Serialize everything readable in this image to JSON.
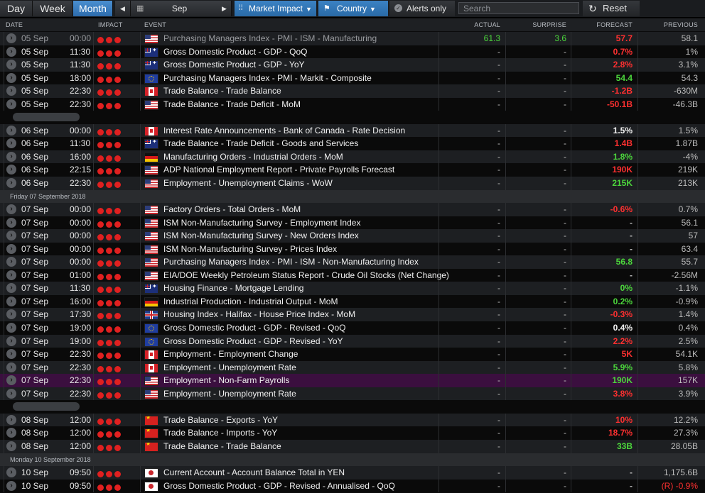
{
  "toolbar": {
    "day": "Day",
    "week": "Week",
    "month": "Month",
    "prev": "◀",
    "calendar_icon": "calendar-icon",
    "period": "Sep",
    "next": "▶",
    "market_impact": "Market Impact",
    "country": "Country",
    "alerts_only": "Alerts only",
    "search_placeholder": "Search",
    "reset": "Reset"
  },
  "columns": {
    "date": "DATE",
    "impact": "IMPACT",
    "event": "EVENT",
    "actual": "ACTUAL",
    "surprise": "SURPRISE",
    "forecast": "FORECAST",
    "previous": "PREVIOUS"
  },
  "colors": {
    "accent": "#2d6cad",
    "positive": "#4cd63c",
    "negative": "#ff3030",
    "impact": "#e02020",
    "highlight": "#3b0f3f"
  },
  "rows": [
    {
      "kind": "row",
      "date": "05 Sep",
      "time": "00:00",
      "flag": "us",
      "event": "Purchasing Managers Index - PMI - ISM - Manufacturing",
      "actual": "61.3",
      "actual_c": "pos",
      "surprise": "3.6",
      "surprise_c": "pos",
      "forecast": "57.7",
      "forecast_c": "neg",
      "previous": "58.1",
      "dim": true
    },
    {
      "kind": "row",
      "date": "05 Sep",
      "time": "11:30",
      "flag": "au",
      "event": "Gross Domestic Product - GDP - QoQ",
      "actual": "-",
      "surprise": "-",
      "forecast": "0.7%",
      "forecast_c": "neg",
      "previous": "1%"
    },
    {
      "kind": "row",
      "date": "05 Sep",
      "time": "11:30",
      "flag": "au",
      "event": "Gross Domestic Product - GDP - YoY",
      "actual": "-",
      "surprise": "-",
      "forecast": "2.8%",
      "forecast_c": "neg",
      "previous": "3.1%"
    },
    {
      "kind": "row",
      "date": "05 Sep",
      "time": "18:00",
      "flag": "eu",
      "event": "Purchasing Managers Index - PMI - Markit - Composite",
      "actual": "-",
      "surprise": "-",
      "forecast": "54.4",
      "forecast_c": "pos",
      "previous": "54.3"
    },
    {
      "kind": "row",
      "date": "05 Sep",
      "time": "22:30",
      "flag": "ca",
      "event": "Trade Balance - Trade Balance",
      "actual": "-",
      "surprise": "-",
      "forecast": "-1.2B",
      "forecast_c": "neg",
      "previous": "-630M"
    },
    {
      "kind": "row",
      "date": "05 Sep",
      "time": "22:30",
      "flag": "us",
      "event": "Trade Balance - Trade Deficit - MoM",
      "actual": "-",
      "surprise": "-",
      "forecast": "-50.1B",
      "forecast_c": "neg",
      "previous": "-46.3B"
    },
    {
      "kind": "gap"
    },
    {
      "kind": "row",
      "date": "06 Sep",
      "time": "00:00",
      "flag": "ca",
      "event": "Interest Rate Announcements - Bank of Canada - Rate Decision",
      "actual": "-",
      "surprise": "-",
      "forecast": "1.5%",
      "forecast_c": "neu",
      "previous": "1.5%"
    },
    {
      "kind": "row",
      "date": "06 Sep",
      "time": "11:30",
      "flag": "au",
      "event": "Trade Balance - Trade Deficit - Goods and Services",
      "actual": "-",
      "surprise": "-",
      "forecast": "1.4B",
      "forecast_c": "neg",
      "previous": "1.87B"
    },
    {
      "kind": "row",
      "date": "06 Sep",
      "time": "16:00",
      "flag": "de",
      "event": "Manufacturing Orders - Industrial Orders - MoM",
      "actual": "-",
      "surprise": "-",
      "forecast": "1.8%",
      "forecast_c": "pos",
      "previous": "-4%"
    },
    {
      "kind": "row",
      "date": "06 Sep",
      "time": "22:15",
      "flag": "us",
      "event": "ADP National Employment Report - Private Payrolls Forecast",
      "actual": "-",
      "surprise": "-",
      "forecast": "190K",
      "forecast_c": "neg",
      "previous": "219K"
    },
    {
      "kind": "row",
      "date": "06 Sep",
      "time": "22:30",
      "flag": "us",
      "event": "Employment - Unemployment Claims - WoW",
      "actual": "-",
      "surprise": "-",
      "forecast": "215K",
      "forecast_c": "pos",
      "previous": "213K"
    },
    {
      "kind": "group",
      "label": "Friday 07 September 2018"
    },
    {
      "kind": "row",
      "date": "07 Sep",
      "time": "00:00",
      "flag": "us",
      "event": "Factory Orders - Total Orders - MoM",
      "actual": "-",
      "surprise": "-",
      "forecast": "-0.6%",
      "forecast_c": "neg",
      "previous": "0.7%"
    },
    {
      "kind": "row",
      "date": "07 Sep",
      "time": "00:00",
      "flag": "us",
      "event": "ISM Non-Manufacturing Survey - Employment Index",
      "actual": "-",
      "surprise": "-",
      "forecast": "-",
      "forecast_c": "dash",
      "previous": "56.1"
    },
    {
      "kind": "row",
      "date": "07 Sep",
      "time": "00:00",
      "flag": "us",
      "event": "ISM Non-Manufacturing Survey - New Orders Index",
      "actual": "-",
      "surprise": "-",
      "forecast": "-",
      "forecast_c": "dash",
      "previous": "57"
    },
    {
      "kind": "row",
      "date": "07 Sep",
      "time": "00:00",
      "flag": "us",
      "event": "ISM Non-Manufacturing Survey - Prices Index",
      "actual": "-",
      "surprise": "-",
      "forecast": "-",
      "forecast_c": "dash",
      "previous": "63.4"
    },
    {
      "kind": "row",
      "date": "07 Sep",
      "time": "00:00",
      "flag": "us",
      "event": "Purchasing Managers Index - PMI - ISM - Non-Manufacturing Index",
      "actual": "-",
      "surprise": "-",
      "forecast": "56.8",
      "forecast_c": "pos",
      "previous": "55.7"
    },
    {
      "kind": "row",
      "date": "07 Sep",
      "time": "01:00",
      "flag": "us",
      "event": "EIA/DOE Weekly Petroleum Status Report - Crude Oil Stocks (Net Change)",
      "actual": "-",
      "surprise": "-",
      "forecast": "-",
      "forecast_c": "dash",
      "previous": "-2.56M"
    },
    {
      "kind": "row",
      "date": "07 Sep",
      "time": "11:30",
      "flag": "au",
      "event": "Housing Finance - Mortgage Lending",
      "actual": "-",
      "surprise": "-",
      "forecast": "0%",
      "forecast_c": "pos",
      "previous": "-1.1%"
    },
    {
      "kind": "row",
      "date": "07 Sep",
      "time": "16:00",
      "flag": "de",
      "event": "Industrial Production - Industrial Output - MoM",
      "actual": "-",
      "surprise": "-",
      "forecast": "0.2%",
      "forecast_c": "pos",
      "previous": "-0.9%"
    },
    {
      "kind": "row",
      "date": "07 Sep",
      "time": "17:30",
      "flag": "gb",
      "event": "Housing Index - Halifax - House Price Index - MoM",
      "actual": "-",
      "surprise": "-",
      "forecast": "-0.3%",
      "forecast_c": "neg",
      "previous": "1.4%"
    },
    {
      "kind": "row",
      "date": "07 Sep",
      "time": "19:00",
      "flag": "eu",
      "event": "Gross Domestic Product - GDP - Revised - QoQ",
      "actual": "-",
      "surprise": "-",
      "forecast": "0.4%",
      "forecast_c": "neu",
      "previous": "0.4%"
    },
    {
      "kind": "row",
      "date": "07 Sep",
      "time": "19:00",
      "flag": "eu",
      "event": "Gross Domestic Product - GDP - Revised - YoY",
      "actual": "-",
      "surprise": "-",
      "forecast": "2.2%",
      "forecast_c": "neg",
      "previous": "2.5%"
    },
    {
      "kind": "row",
      "date": "07 Sep",
      "time": "22:30",
      "flag": "ca",
      "event": "Employment - Employment Change",
      "actual": "-",
      "surprise": "-",
      "forecast": "5K",
      "forecast_c": "neg",
      "previous": "54.1K"
    },
    {
      "kind": "row",
      "date": "07 Sep",
      "time": "22:30",
      "flag": "ca",
      "event": "Employment - Unemployment Rate",
      "actual": "-",
      "surprise": "-",
      "forecast": "5.9%",
      "forecast_c": "pos",
      "previous": "5.8%"
    },
    {
      "kind": "row",
      "date": "07 Sep",
      "time": "22:30",
      "flag": "us",
      "event": "Employment - Non-Farm Payrolls",
      "actual": "-",
      "surprise": "-",
      "forecast": "190K",
      "forecast_c": "pos",
      "previous": "157K",
      "highlight": true
    },
    {
      "kind": "row",
      "date": "07 Sep",
      "time": "22:30",
      "flag": "us",
      "event": "Employment - Unemployment Rate",
      "actual": "-",
      "surprise": "-",
      "forecast": "3.8%",
      "forecast_c": "neg",
      "previous": "3.9%"
    },
    {
      "kind": "gap"
    },
    {
      "kind": "row",
      "date": "08 Sep",
      "time": "12:00",
      "flag": "cn",
      "event": "Trade Balance - Exports - YoY",
      "actual": "-",
      "surprise": "-",
      "forecast": "10%",
      "forecast_c": "neg",
      "previous": "12.2%"
    },
    {
      "kind": "row",
      "date": "08 Sep",
      "time": "12:00",
      "flag": "cn",
      "event": "Trade Balance - Imports - YoY",
      "actual": "-",
      "surprise": "-",
      "forecast": "18.7%",
      "forecast_c": "neg",
      "previous": "27.3%"
    },
    {
      "kind": "row",
      "date": "08 Sep",
      "time": "12:00",
      "flag": "cn",
      "event": "Trade Balance - Trade Balance",
      "actual": "-",
      "surprise": "-",
      "forecast": "33B",
      "forecast_c": "pos",
      "previous": "28.05B"
    },
    {
      "kind": "group",
      "label": "Monday 10 September 2018"
    },
    {
      "kind": "row",
      "date": "10 Sep",
      "time": "09:50",
      "flag": "jp",
      "event": "Current Account - Account Balance Total in YEN",
      "actual": "-",
      "surprise": "-",
      "forecast": "-",
      "forecast_c": "dash",
      "previous": "1,175.6B"
    },
    {
      "kind": "row",
      "date": "10 Sep",
      "time": "09:50",
      "flag": "jp",
      "event": "Gross Domestic Product - GDP - Revised - Annualised - QoQ",
      "actual": "-",
      "surprise": "-",
      "forecast": "-",
      "forecast_c": "dash",
      "previous": "(R) -0.9%",
      "previous_c": "neg"
    }
  ]
}
